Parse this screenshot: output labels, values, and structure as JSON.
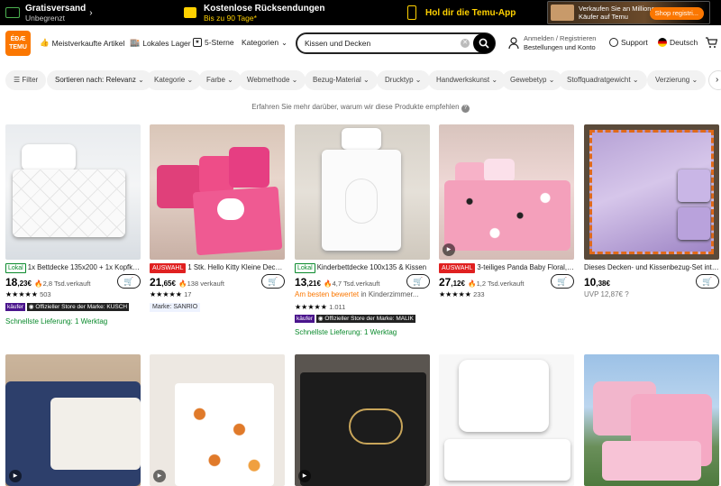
{
  "topbar": {
    "free_shipping": "Gratisversand",
    "unlimited": "Unbegrenzt",
    "free_returns": "Kostenlose Rücksendungen",
    "return_days": "Bis zu 90 Tage*",
    "app_promo": "Hol dir die Temu-App",
    "ad_text_line1": "Verkaufen Sie an Millionen",
    "ad_text_line2": "Käufer auf Temu",
    "ad_button": "Shop registri..."
  },
  "header": {
    "logo_line1": "ÉĐÆ",
    "logo_line2": "TEMU",
    "bestsellers": "Meistverkaufte Artikel",
    "local_stock": "Lokales Lager",
    "five_stars": "5-Sterne",
    "categories": "Kategorien",
    "search_value": "Kissen und Decken",
    "account_line1": "Anmelden / Registrieren",
    "account_line2": "Bestellungen und Konto",
    "support": "Support",
    "language": "Deutsch"
  },
  "filters": [
    "Filter",
    "Sortieren nach: Relevanz",
    "Kategorie",
    "Farbe",
    "Webmethode",
    "Bezug-Material",
    "Drucktyp",
    "Handwerkskunst",
    "Gewebetyp",
    "Stoffquadratgewicht",
    "Verzierung"
  ],
  "info_text": "Erfahren Sie mehr darüber, warum wir diese Produkte empfehlen",
  "products": [
    {
      "tag": "Lokal",
      "tag_type": "l",
      "title": "1x Bettdecke 135x200 + 1x Kopfkissen",
      "price_int": "18",
      "price_dec": ",23€",
      "sold": "2,8 Tsd.verkauft",
      "stars": "★★★★★",
      "reviews": "503",
      "badge1": "käufer",
      "badge2": "◉ Offizieller Store der Marke: KUSCH",
      "delivery": "Schnellste Lieferung: 1 Werktag"
    },
    {
      "tag": "AUSWAHL",
      "tag_type": "a",
      "title": "1 Stk. Hello Kitty Kleine Decke, ...",
      "price_int": "21",
      "price_dec": ",65€",
      "sold": "138 verkauft",
      "stars": "★★★★★",
      "reviews": "17",
      "brand": "Marke: SANRIO"
    },
    {
      "tag": "Lokal",
      "tag_type": "l",
      "title": "Kinderbettdecke 100x135 & Kissen",
      "price_int": "13",
      "price_dec": ",21€",
      "sold": "4,7 Tsd.verkauft",
      "best_rated": "Am besten bewertet",
      "best_rated_in": "in Kinderzimmer...",
      "stars": "★★★★★",
      "reviews": "1.011",
      "badge1": "käufer",
      "badge2": "◉ Offizieller Store der Marke: MALIK",
      "delivery": "Schnellste Lieferung: 1 Werktag"
    },
    {
      "tag": "AUSWAHL",
      "tag_type": "a",
      "title": "3-teiliges Panda Baby Floral, ha...",
      "price_int": "27",
      "price_dec": ",12€",
      "sold": "1,2 Tsd.verkauft",
      "stars": "★★★★★",
      "reviews": "233"
    },
    {
      "tag": "",
      "tag_type": "",
      "title": "Dieses Decken- und Kissenbezug-Set integ...",
      "price_int": "10",
      "price_dec": ",38€",
      "uvp": "UVP 12,87€"
    }
  ],
  "colors": {
    "accent": "#fb7701",
    "green": "#0a8a2c",
    "red_tag": "#e02020"
  }
}
